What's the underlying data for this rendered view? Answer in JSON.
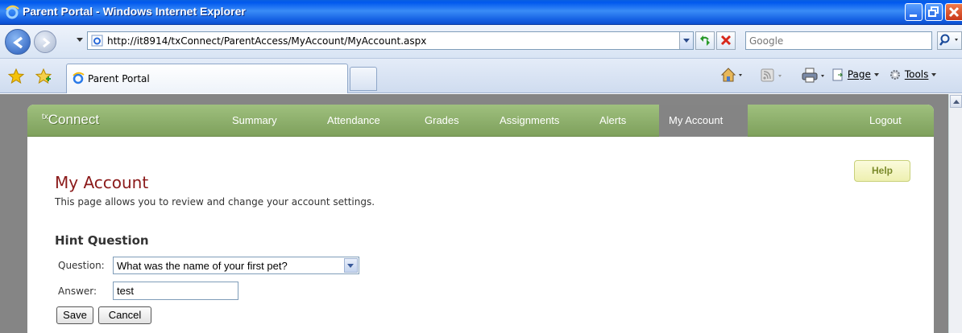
{
  "window": {
    "title": "Parent Portal - Windows Internet Explorer"
  },
  "address_bar": {
    "url": "http://it8914/txConnect/ParentAccess/MyAccount/MyAccount.aspx",
    "search_placeholder": "Google"
  },
  "tabs": [
    {
      "label": "Parent Portal"
    }
  ],
  "command_bar": {
    "page_label": "Page",
    "tools_label": "Tools"
  },
  "site": {
    "brand_prefix": "tx",
    "brand_name": "Connect",
    "nav": [
      {
        "label": "Summary",
        "active": false
      },
      {
        "label": "Attendance",
        "active": false
      },
      {
        "label": "Grades",
        "active": false
      },
      {
        "label": "Assignments",
        "active": false
      },
      {
        "label": "Alerts",
        "active": false
      },
      {
        "label": "My Account",
        "active": true
      },
      {
        "label": "Logout",
        "active": false
      }
    ],
    "accent_color": "#8fb26d",
    "active_nav_color": "#848484"
  },
  "page": {
    "title": "My Account",
    "description": "This page allows you to review and change your account settings.",
    "help_label": "Help",
    "title_color": "#8b1a1a"
  },
  "hint_section": {
    "title": "Hint Question",
    "question_label": "Question:",
    "question_value": "What was the name of your first pet?",
    "answer_label": "Answer:",
    "answer_value": "test",
    "save_label": "Save",
    "cancel_label": "Cancel"
  }
}
